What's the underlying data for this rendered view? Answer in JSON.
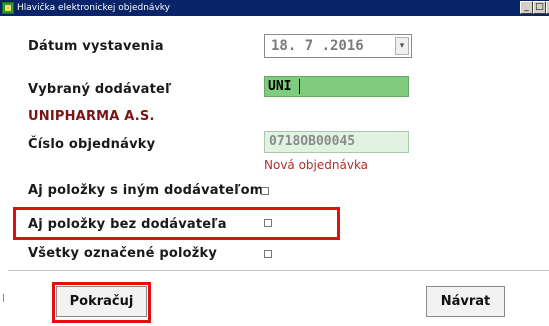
{
  "window": {
    "title": "Hlavička elektronickej objednávky",
    "controls": {
      "minimize": "_",
      "maximize": "□",
      "close": "×"
    }
  },
  "form": {
    "date": {
      "label": "Dátum vystavenia",
      "value": "18. 7 .2016"
    },
    "supplier": {
      "label": "Vybraný dodávateľ",
      "value": "UNI",
      "name": "UNIPHARMA A.S."
    },
    "order": {
      "label": "Číslo objednávky",
      "value": "0718OB00045",
      "status": "Nová objednávka"
    },
    "options": [
      {
        "label": "Aj položky s iným dodávateľom",
        "checked": false
      },
      {
        "label": "Aj položky bez dodávateľa",
        "checked": false
      },
      {
        "label": "Všetky označené položky",
        "checked": false
      }
    ]
  },
  "buttons": {
    "continue": "Pokračuj",
    "back": "Návrat"
  },
  "colors": {
    "titlebar": "#0a246a",
    "supplier_field": "#7fcc7f",
    "order_field": "#e2f2e2",
    "supplier_name": "#7a1515",
    "status_text": "#b03030",
    "highlight": "#e01010"
  }
}
